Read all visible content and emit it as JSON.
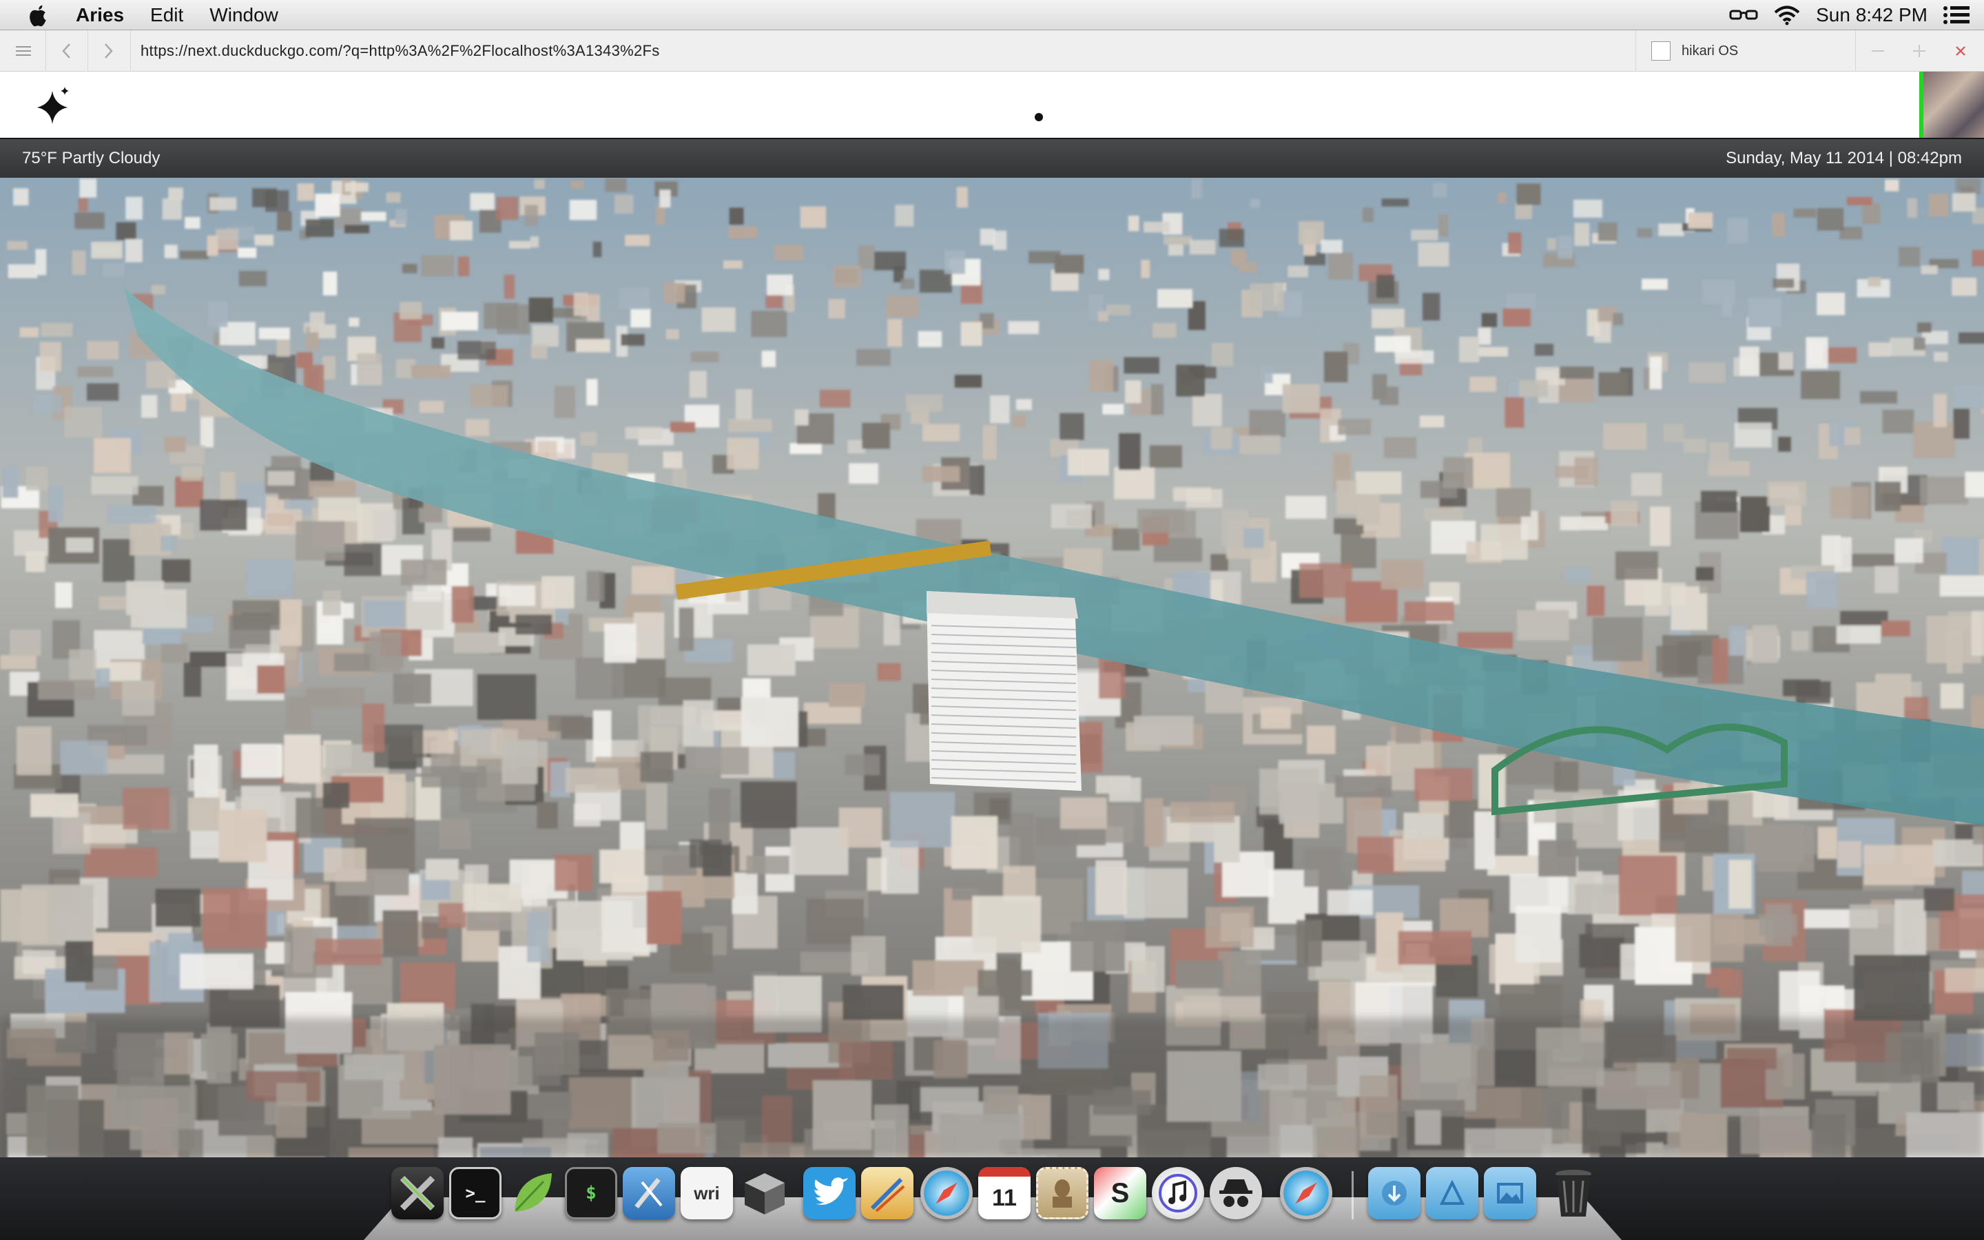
{
  "menubar": {
    "app_name": "Aries",
    "menus": [
      "Edit",
      "Window"
    ],
    "clock": "Sun 8:42 PM"
  },
  "browser": {
    "url": "https://next.duckduckgo.com/?q=http%3A%2F%2Flocalhost%3A1343%2Fs",
    "tab_title": "hikari OS"
  },
  "page": {
    "weather": "75°F Partly Cloudy",
    "datetime": "Sunday, May 11 2014 | 08:42pm"
  },
  "dock": {
    "apps": [
      {
        "name": "x-app-icon",
        "glyph": "X"
      },
      {
        "name": "terminal-icon",
        "glyph": ">_"
      },
      {
        "name": "leaf-icon",
        "glyph": ""
      },
      {
        "name": "console-icon",
        "glyph": "$"
      },
      {
        "name": "xcode-icon",
        "glyph": ""
      },
      {
        "name": "writer-icon",
        "glyph": "wri"
      },
      {
        "name": "cube-icon",
        "glyph": ""
      },
      {
        "name": "twitter-icon",
        "glyph": ""
      },
      {
        "name": "sketch-icon",
        "glyph": ""
      },
      {
        "name": "safari-icon",
        "glyph": ""
      },
      {
        "name": "calendar-icon",
        "glyph": "11"
      },
      {
        "name": "stamp-icon",
        "glyph": ""
      },
      {
        "name": "sublime-icon",
        "glyph": "S"
      },
      {
        "name": "itunes-icon",
        "glyph": ""
      },
      {
        "name": "incognito-icon",
        "glyph": ""
      },
      {
        "name": "safari-2-icon",
        "glyph": ""
      },
      {
        "name": "downloads-folder-icon",
        "glyph": ""
      },
      {
        "name": "applications-folder-icon",
        "glyph": ""
      },
      {
        "name": "pictures-folder-icon",
        "glyph": ""
      },
      {
        "name": "trash-icon",
        "glyph": ""
      }
    ]
  },
  "colors": {
    "accent_green": "#22d722",
    "header_bar": "#3a3c3e",
    "river": "#5f9ea3",
    "twitter_blue": "#2f9be0"
  }
}
